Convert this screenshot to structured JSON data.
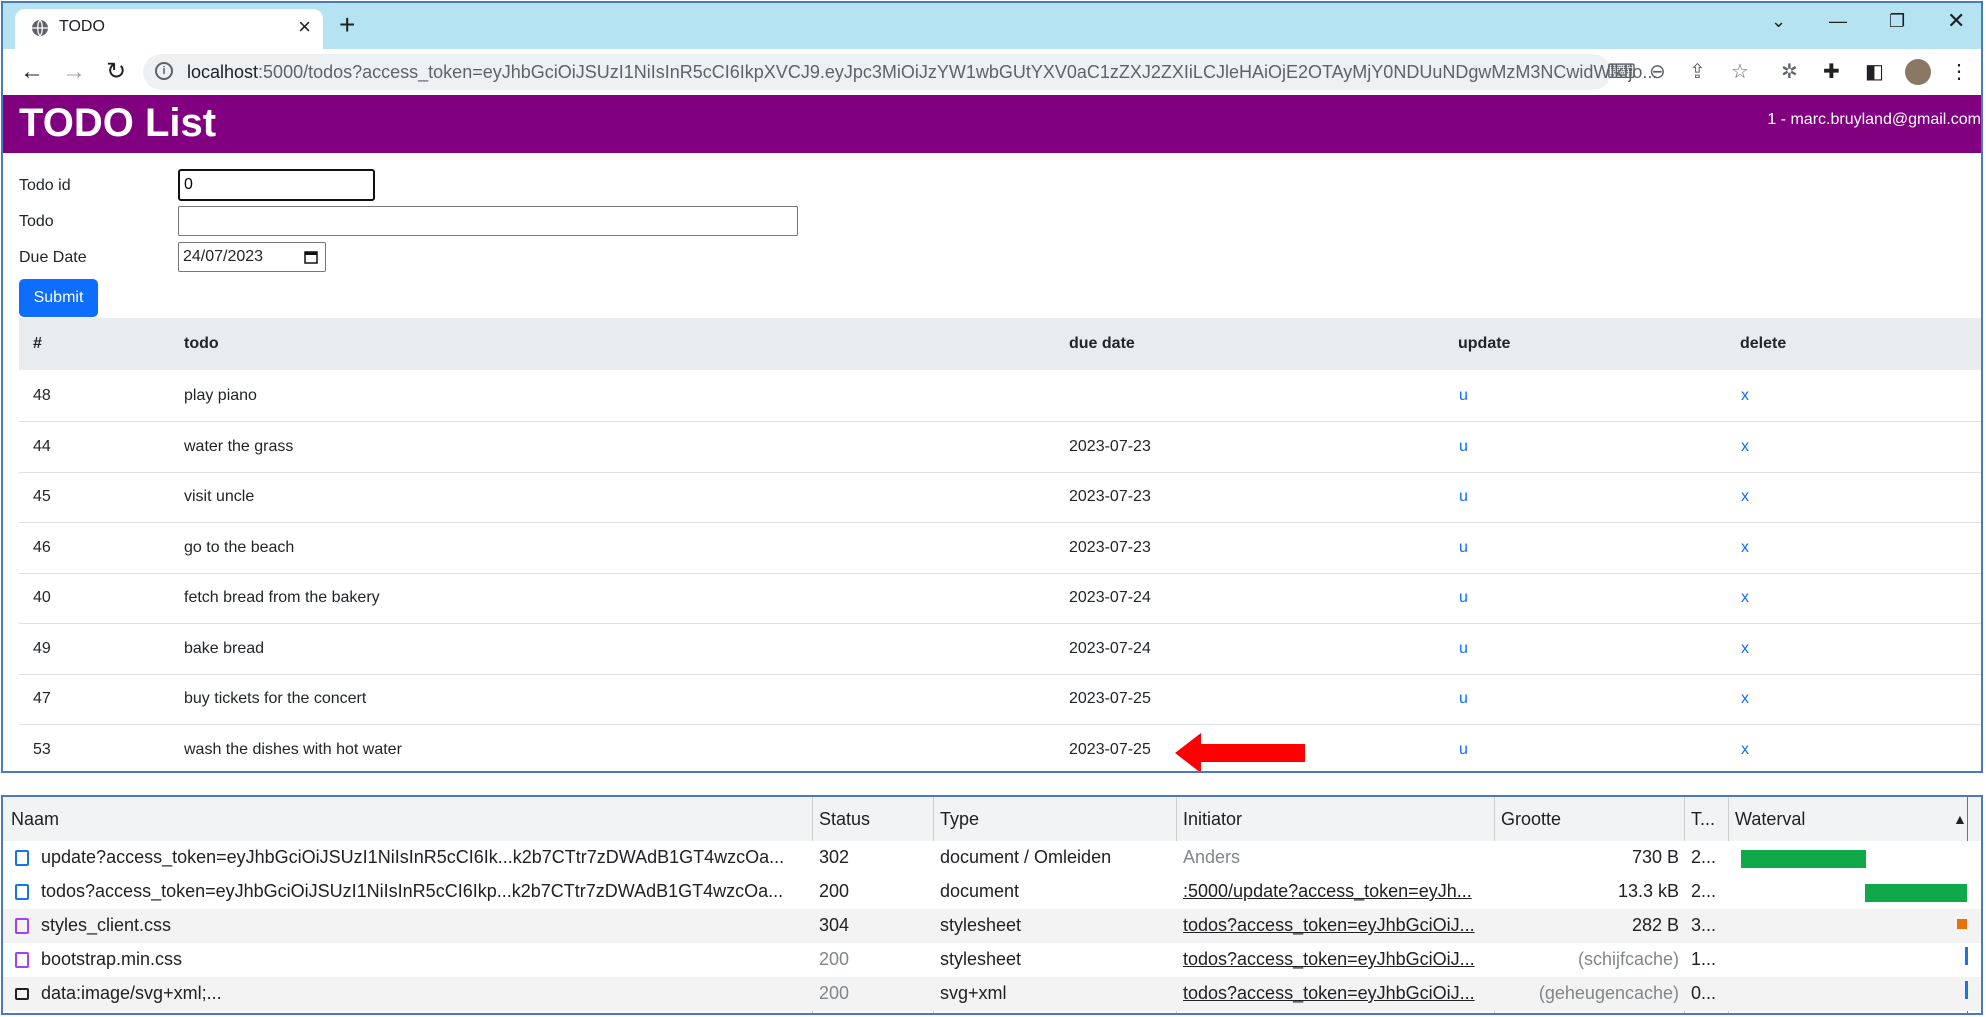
{
  "browser": {
    "tab_title": "TODO",
    "url_host": "localhost",
    "url_rest": ":5000/todos?access_token=eyJhbGciOiJSUzI1NiIsInR5cCI6IkpXVCJ9.eyJpc3MiOiJzYW1wbGUtYXV0aC1zZXJ2ZXIiLCJleHAiOjE2OTAyMjY0NDUuNDgwMzM3NCwidWlkIjo..."
  },
  "page": {
    "title": "TODO List",
    "user": "1 - marc.bruyland@gmail.com",
    "form": {
      "todo_id_label": "Todo id",
      "todo_id_value": "0",
      "todo_label": "Todo",
      "todo_value": "",
      "due_label": "Due Date",
      "due_value": "24/07/2023",
      "submit": "Submit"
    },
    "table": {
      "headers": [
        "#",
        "todo",
        "due date",
        "update",
        "delete"
      ],
      "rows": [
        {
          "id": "48",
          "todo": "play piano",
          "due": "",
          "update": "u",
          "delete": "x"
        },
        {
          "id": "44",
          "todo": "water the grass",
          "due": "2023-07-23",
          "update": "u",
          "delete": "x"
        },
        {
          "id": "45",
          "todo": "visit uncle",
          "due": "2023-07-23",
          "update": "u",
          "delete": "x"
        },
        {
          "id": "46",
          "todo": "go to the beach",
          "due": "2023-07-23",
          "update": "u",
          "delete": "x"
        },
        {
          "id": "40",
          "todo": "fetch bread from the bakery",
          "due": "2023-07-24",
          "update": "u",
          "delete": "x"
        },
        {
          "id": "49",
          "todo": "bake bread",
          "due": "2023-07-24",
          "update": "u",
          "delete": "x"
        },
        {
          "id": "47",
          "todo": "buy tickets for the concert",
          "due": "2023-07-25",
          "update": "u",
          "delete": "x"
        },
        {
          "id": "53",
          "todo": "wash the dishes with hot water",
          "due": "2023-07-25",
          "update": "u",
          "delete": "x"
        }
      ]
    },
    "header_color": "#800080",
    "arrow_color": "#ff0000"
  },
  "devtools": {
    "headers": [
      "Naam",
      "Status",
      "Type",
      "Initiator",
      "Grootte",
      "T...",
      "Waterval"
    ],
    "rows": [
      {
        "name": "update?access_token=eyJhbGciOiJSUzI1NiIsInR5cCI6Ik...k2b7CTtr7zDWAdB1GT4wzcOa...",
        "status": "302",
        "type": "document / Omleiden",
        "initiator": "Anders",
        "size": "730 B",
        "time": "2...",
        "icon": "document-icon"
      },
      {
        "name": "todos?access_token=eyJhbGciOiJSUzI1NiIsInR5cCI6Ikp...k2b7CTtr7zDWAdB1GT4wzcOa...",
        "status": "200",
        "type": "document",
        "initiator": ":5000/update?access_token=eyJh...",
        "size": "13.3 kB",
        "time": "2...",
        "icon": "document-icon"
      },
      {
        "name": "styles_client.css",
        "status": "304",
        "type": "stylesheet",
        "initiator": "todos?access_token=eyJhbGciOiJ...",
        "size": "282 B",
        "time": "3...",
        "icon": "stylesheet-icon"
      },
      {
        "name": "bootstrap.min.css",
        "status": "200",
        "type": "stylesheet",
        "initiator": "todos?access_token=eyJhbGciOiJ...",
        "size": "(schijfcache)",
        "time": "1...",
        "icon": "stylesheet-icon"
      },
      {
        "name": "data:image/svg+xml;...",
        "status": "200",
        "type": "svg+xml",
        "initiator": "todos?access_token=eyJhbGciOiJ...",
        "size": "(geheugencache)",
        "time": "0...",
        "icon": "image-icon"
      }
    ]
  }
}
